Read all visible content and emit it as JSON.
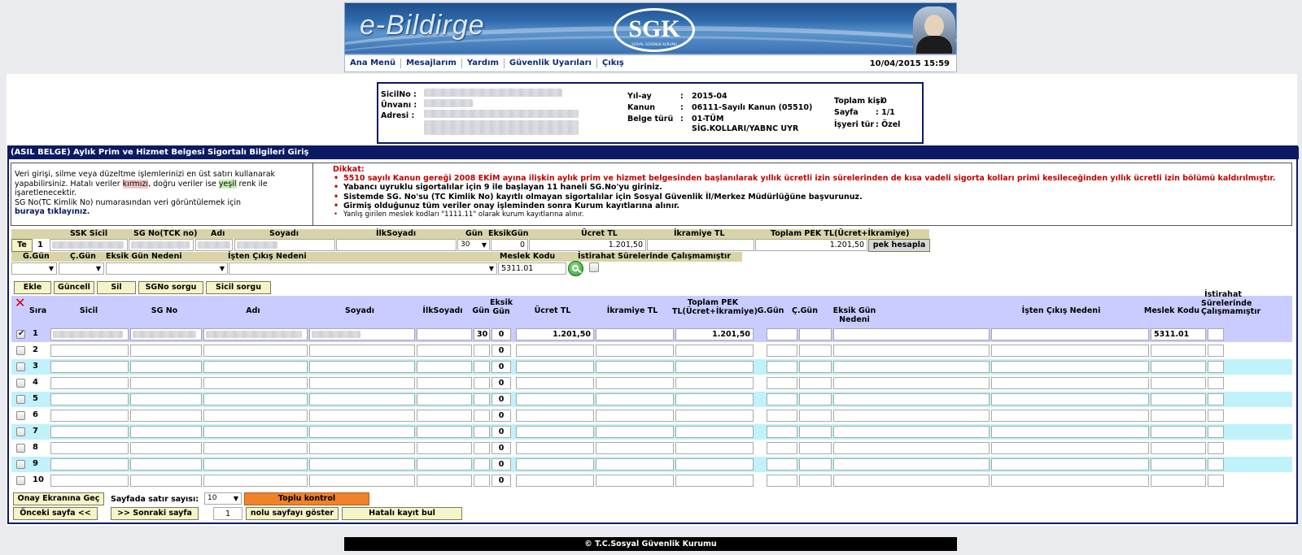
{
  "header": {
    "logo_text": "e-Bildirge",
    "sgk_text": "SGK",
    "sgk_sub": "SOSYAL GÜVENLİK KURUMU",
    "menu": [
      "Ana Menü",
      "Mesajlarım",
      "Yardım",
      "Güvenlik Uyarıları",
      "Çıkış"
    ],
    "datetime": "10/04/2015 15:59"
  },
  "employer": {
    "sicilno_label": "SicilNo :",
    "unvan_label": "Ünvanı :",
    "adres_label": "Adresi :",
    "yil_ay_label": "Yıl-ay",
    "yil_ay_value": "2015-04",
    "kanun_label": "Kanun",
    "kanun_value": "06111-Sayılı Kanun (05510)",
    "belge_label": "Belge türü",
    "belge_value_1": "01-TÜM",
    "belge_value_2": "SİG.KOLLARI/YABNC UYR",
    "colon": ":",
    "toplam_kisi_label": "Toplam kişi",
    "toplam_kisi_value": ": 0",
    "sayfa_label": "Sayfa",
    "sayfa_value": ": 1/1",
    "isyeri_label": "İşyeri tür",
    "isyeri_value": ": Özel"
  },
  "section_title": "(ASIL BELGE) Aylık Prim ve Hizmet Belgesi Sigortalı Bilgileri Giriş",
  "notice_left": {
    "p1_a": "Veri girişi, silme veya düzeltme işlemlerinizi en üst satırı kullanarak yapabilirsiniz. Hatalı veriler ",
    "p1_red": "kırmızı",
    "p1_b": ", doğru veriler ise ",
    "p1_green": "yeşil",
    "p1_c": " renk ile işaretlenecektir.",
    "p2": "SG No(TC Kimlik No) numarasından veri görüntülemek için",
    "p2_link": "buraya tıklayınız."
  },
  "notice_right": {
    "title": "Dikkat:",
    "items": [
      "5510 sayılı Kanun gereği 2008 EKİM ayına ilişkin aylık prim ve hizmet belgesinden başlanılarak yıllık ücretli izin sürelerinden de kısa vadeli sigorta kolları primi kesileceğinden yıllık ücretli izin bölümü kaldırılmıştır.",
      "Yabancı uyruklu sigortalılar için 9 ile başlayan 11 haneli SG.No'yu giriniz.",
      "Sistemde SG. No'su (TC Kimlik No) kayıtlı olmayan sigortalılar için Sosyal Güvenlik İl/Merkez Müdürlüğüne başvurunuz.",
      "Girmiş olduğunuz tüm veriler onay işleminden sonra Kurum kayıtlarına alınır.",
      "Yanlış girilen meslek kodları \"1111.11\" olarak kurum kayıtlarına alınır."
    ]
  },
  "entry": {
    "labels_row1": [
      "SSK Sicil",
      "SG No(TCK no)",
      "Adı",
      "Soyadı",
      "İlkSoyadı",
      "Gün",
      "EksikGün",
      "Ücret TL",
      "İkramiye TL",
      "Toplam PEK TL(Ücret+İkramiye)"
    ],
    "te_label": "Te",
    "row_index": "1",
    "gun": "30",
    "eksik_gun": "0",
    "ucret": "1.201,50",
    "toplam_pek": "1.201,50",
    "pek_button": "pek hesapla",
    "labels_row2": [
      "G.Gün",
      "Ç.Gün",
      "Eksik Gün Nedeni",
      "İşten Çıkış Nedeni",
      "Meslek Kodu",
      "İstirahat Sürelerinde Çalışmamıştır"
    ],
    "meslek_kodu": "5311.01"
  },
  "buttons": {
    "ekle": "Ekle",
    "guncell": "Güncell",
    "sil": "Sil",
    "sgno": "SGNo sorgu",
    "sicil": "Sicil sorgu"
  },
  "grid": {
    "headers": [
      "Sıra",
      "Sicil",
      "SG No",
      "Adı",
      "Soyadı",
      "İlkSoyadı",
      "Gün",
      "Eksik Gün",
      "Ücret TL",
      "İkramiye TL",
      "Toplam PEK TL(Ücret+İkramiye)",
      "G.Gün",
      "Ç.Gün",
      "Eksik Gün Nedeni",
      "İşten Çıkış Nedeni",
      "Meslek Kodu",
      "İstirahat Sürelerinde Çalışmamıştır"
    ],
    "rows": [
      {
        "no": "1",
        "checked": true,
        "gun": "30",
        "eksik": "0",
        "ucret": "1.201,50",
        "toplam": "1.201,50",
        "meslek": "5311.01"
      },
      {
        "no": "2",
        "checked": false,
        "gun": "",
        "eksik": "0",
        "ucret": "",
        "toplam": "",
        "meslek": ""
      },
      {
        "no": "3",
        "checked": false,
        "gun": "",
        "eksik": "0",
        "ucret": "",
        "toplam": "",
        "meslek": ""
      },
      {
        "no": "4",
        "checked": false,
        "gun": "",
        "eksik": "0",
        "ucret": "",
        "toplam": "",
        "meslek": ""
      },
      {
        "no": "5",
        "checked": false,
        "gun": "",
        "eksik": "0",
        "ucret": "",
        "toplam": "",
        "meslek": ""
      },
      {
        "no": "6",
        "checked": false,
        "gun": "",
        "eksik": "0",
        "ucret": "",
        "toplam": "",
        "meslek": ""
      },
      {
        "no": "7",
        "checked": false,
        "gun": "",
        "eksik": "0",
        "ucret": "",
        "toplam": "",
        "meslek": ""
      },
      {
        "no": "8",
        "checked": false,
        "gun": "",
        "eksik": "0",
        "ucret": "",
        "toplam": "",
        "meslek": ""
      },
      {
        "no": "9",
        "checked": false,
        "gun": "",
        "eksik": "0",
        "ucret": "",
        "toplam": "",
        "meslek": ""
      },
      {
        "no": "10",
        "checked": false,
        "gun": "",
        "eksik": "0",
        "ucret": "",
        "toplam": "",
        "meslek": ""
      }
    ]
  },
  "bottom": {
    "onay": "Onay Ekranına Geç",
    "sayfada_label": "Sayfada satır sayısı:",
    "sayfada_value": "10",
    "toplu": "Toplu kontrol",
    "onceki": "Önceki sayfa <<",
    "sonraki": ">> Sonraki sayfa",
    "page_no": "1",
    "goster": "nolu sayfayı göster",
    "hatali": "Hatalı kayıt bul"
  },
  "footer": "© T.C.Sosyal Güvenlik Kurumu",
  "colors": {
    "navy": "#0b1a63",
    "warning_red": "#c20000",
    "row_alt": "#bff2fa",
    "header_bg": "#c8ccff",
    "toplu_orange": "#f0822a"
  }
}
